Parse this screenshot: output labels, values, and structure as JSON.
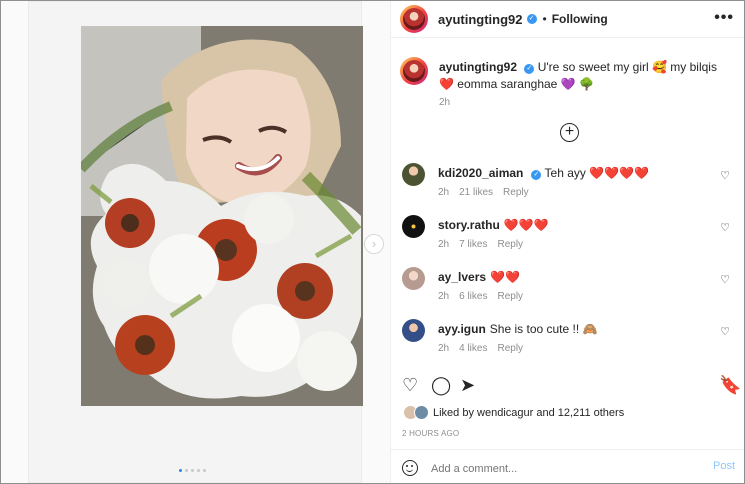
{
  "post": {
    "username": "ayutingting92",
    "follow_separator": "•",
    "following_label": "Following",
    "more_label": "•••",
    "caption": "U're so sweet my girl 🥰 my bilqis ❤️ eomma saranghae 💜 🌳",
    "caption_time": "2h",
    "add_label": "+",
    "likes_text": "Liked by wendicagur and 12,211 others",
    "timestamp": "2 HOURS AGO",
    "input_placeholder": "Add a comment...",
    "post_label": "Post"
  },
  "comments": [
    {
      "user": "kdi2020_aiman",
      "text": "Teh ayy ❤️❤️❤️❤️",
      "time": "2h",
      "likes": "21 likes",
      "reply": "Reply"
    },
    {
      "user": "story.rathu",
      "text": "❤️❤️❤️",
      "time": "2h",
      "likes": "7 likes",
      "reply": "Reply"
    },
    {
      "user": "ay_lvers",
      "text": "❤️❤️",
      "time": "2h",
      "likes": "6 likes",
      "reply": "Reply"
    },
    {
      "user": "ayy.igun",
      "text": "She is too cute !! 🙈",
      "time": "2h",
      "likes": "4 likes",
      "reply": "Reply"
    }
  ],
  "icons": {
    "verified": "verified-badge-icon",
    "heart": "heart-icon",
    "comment": "comment-icon",
    "share": "paper-plane-icon",
    "save": "bookmark-icon",
    "emoji": "smiley-icon",
    "next": "chevron-right-icon"
  },
  "colors": {
    "accent_blue": "#3897f0",
    "post_blue": "#8ec6ff",
    "muted": "#8e8e8e"
  }
}
